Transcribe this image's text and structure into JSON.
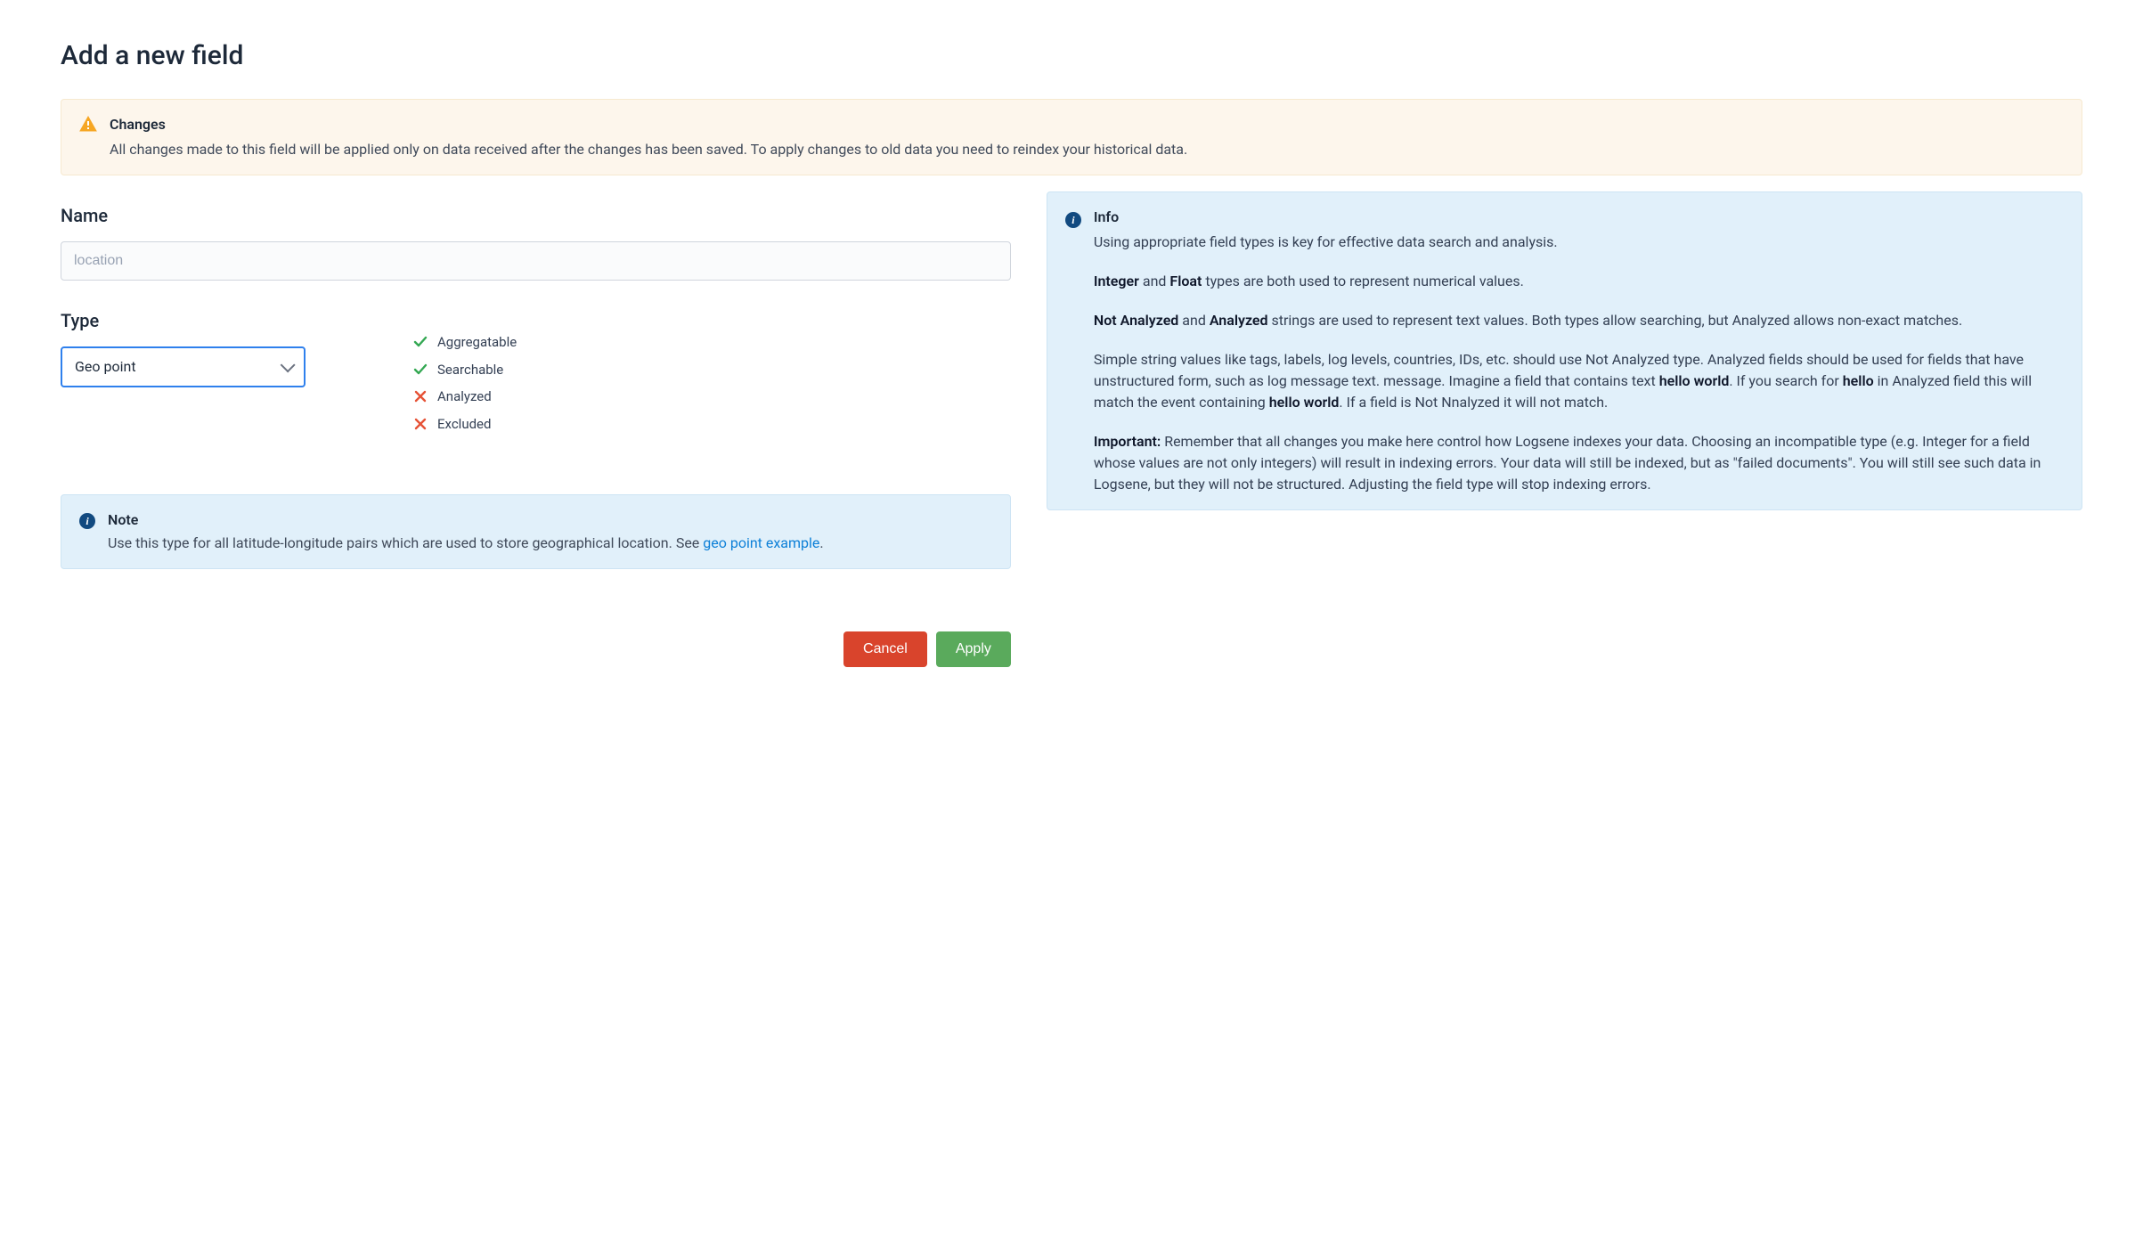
{
  "page": {
    "title": "Add a new field"
  },
  "changes_alert": {
    "title": "Changes",
    "body": "All changes made to this field will be applied only on data received after the changes has been saved. To apply changes to old data you need to reindex your historical data."
  },
  "name": {
    "label": "Name",
    "value": "location"
  },
  "type": {
    "label": "Type",
    "selected": "Geo point",
    "attributes": [
      {
        "label": "Aggregatable",
        "enabled": true
      },
      {
        "label": "Searchable",
        "enabled": true
      },
      {
        "label": "Analyzed",
        "enabled": false
      },
      {
        "label": "Excluded",
        "enabled": false
      }
    ]
  },
  "note": {
    "title": "Note",
    "body_prefix": "Use this type for all latitude-longitude pairs which are used to store geographical location. See ",
    "link_text": "geo point example",
    "body_suffix": "."
  },
  "buttons": {
    "cancel": "Cancel",
    "apply": "Apply"
  },
  "info": {
    "title": "Info",
    "p1": "Using appropriate field types is key for effective data search and analysis.",
    "p2_b1": "Integer",
    "p2_t1": " and ",
    "p2_b2": "Float",
    "p2_t2": " types are both used to represent numerical values.",
    "p3_b1": "Not Analyzed",
    "p3_t1": " and ",
    "p3_b2": "Analyzed",
    "p3_t2": " strings are used to represent text values. Both types allow searching, but Analyzed allows non-exact matches.",
    "p4_t1": "Simple string values like tags, labels, log levels, countries, IDs, etc. should use Not Analyzed type. Analyzed fields should be used for fields that have unstructured form, such as log message text. message. Imagine a field that contains text ",
    "p4_b1": "hello world",
    "p4_t2": ". If you search for  ",
    "p4_b2": "hello",
    "p4_t3": " in Analyzed field this will match the event containing  ",
    "p4_b3": "hello world",
    "p4_t4": ". If a field is Not Nnalyzed it will not match.",
    "p5_b1": "Important:",
    "p5_t1": " Remember that all changes you make here control how Logsene indexes your data. Choosing an incompatible type (e.g. Integer for a field whose values are not only integers) will result in indexing errors. Your data will still be indexed, but as \"failed documents\". You will still see such data in Logsene, but they will not be structured. Adjusting the field type will stop indexing errors."
  }
}
